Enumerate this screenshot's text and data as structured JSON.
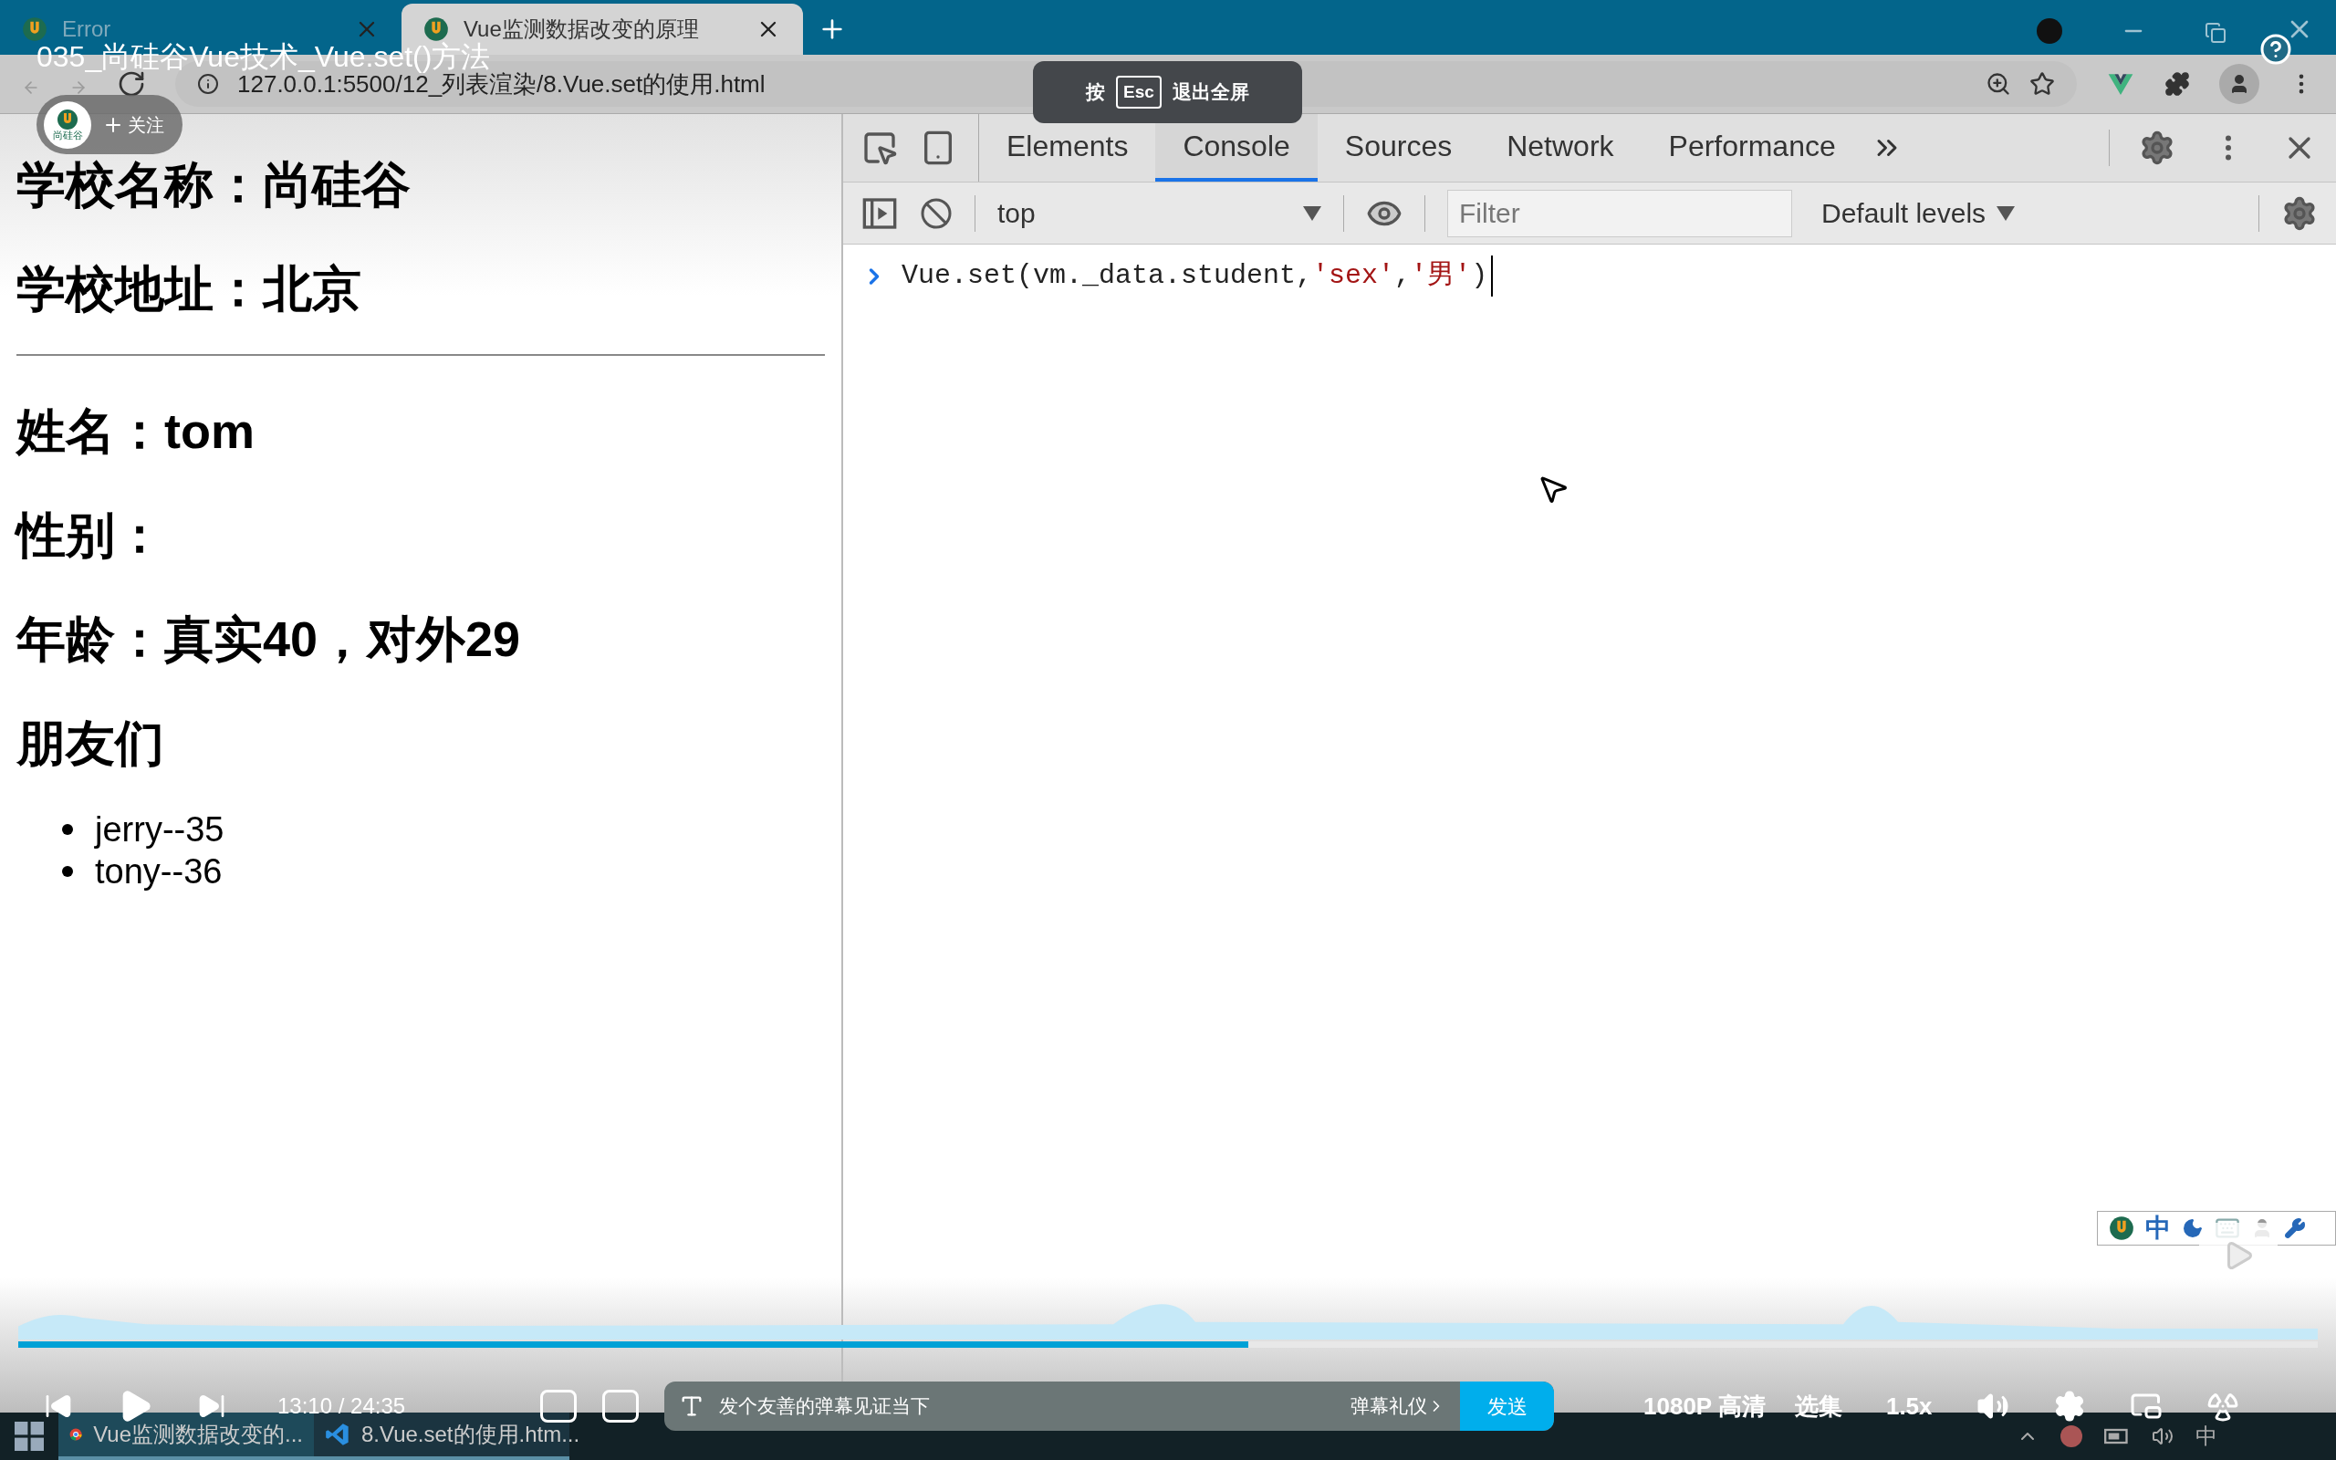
{
  "video": {
    "title": "035_尚硅谷Vue技术_Vue.set()方法",
    "follow": {
      "logo": "尚硅谷",
      "label": "关注"
    },
    "fullscreen_hint": {
      "prefix": "按",
      "key": "Esc",
      "suffix": "退出全屏"
    }
  },
  "browser": {
    "tabs": [
      {
        "title": "Error",
        "selected": false
      },
      {
        "title": "Vue监测数据改变的原理",
        "selected": true
      }
    ],
    "address": "127.0.0.1:5500/12_列表渲染/8.Vue.set的使用.html"
  },
  "page": {
    "school": [
      "学校名称：尚硅谷",
      "学校地址：北京"
    ],
    "student": [
      "姓名：tom",
      "性别：",
      "年龄：真实40，对外29"
    ],
    "friends_heading": "朋友们",
    "friends": [
      "jerry--35",
      "tony--36"
    ]
  },
  "devtools": {
    "tabs": [
      {
        "label": "Elements",
        "selected": false
      },
      {
        "label": "Console",
        "selected": true
      },
      {
        "label": "Sources",
        "selected": false
      },
      {
        "label": "Network",
        "selected": false
      },
      {
        "label": "Performance",
        "selected": false
      }
    ],
    "context": "top",
    "filter_placeholder": "Filter",
    "levels": "Default levels",
    "console_input": [
      {
        "text": "Vue.set(vm._data.student,",
        "kind": "code"
      },
      {
        "text": "'sex'",
        "kind": "string"
      },
      {
        "text": ",",
        "kind": "code"
      },
      {
        "text": "'男'",
        "kind": "string"
      },
      {
        "text": ")",
        "kind": "code"
      }
    ]
  },
  "ime": {
    "mode": "中"
  },
  "player": {
    "progress": {
      "level": 0.535
    },
    "time": "13:10 / 24:35",
    "danmaku_placeholder": "发个友善的弹幕见证当下",
    "etiquette": "弹幕礼仪",
    "send": "发送",
    "quality": "1080P 高清",
    "episodes": "选集",
    "speed": "1.5x"
  },
  "taskbar": {
    "tasks": [
      {
        "title": "Vue监测数据改变的...",
        "kind": "browser",
        "selected": true
      },
      {
        "title": "8.Vue.set的使用.htm...",
        "kind": "editor",
        "selected": false
      }
    ],
    "input_mode": "中"
  }
}
